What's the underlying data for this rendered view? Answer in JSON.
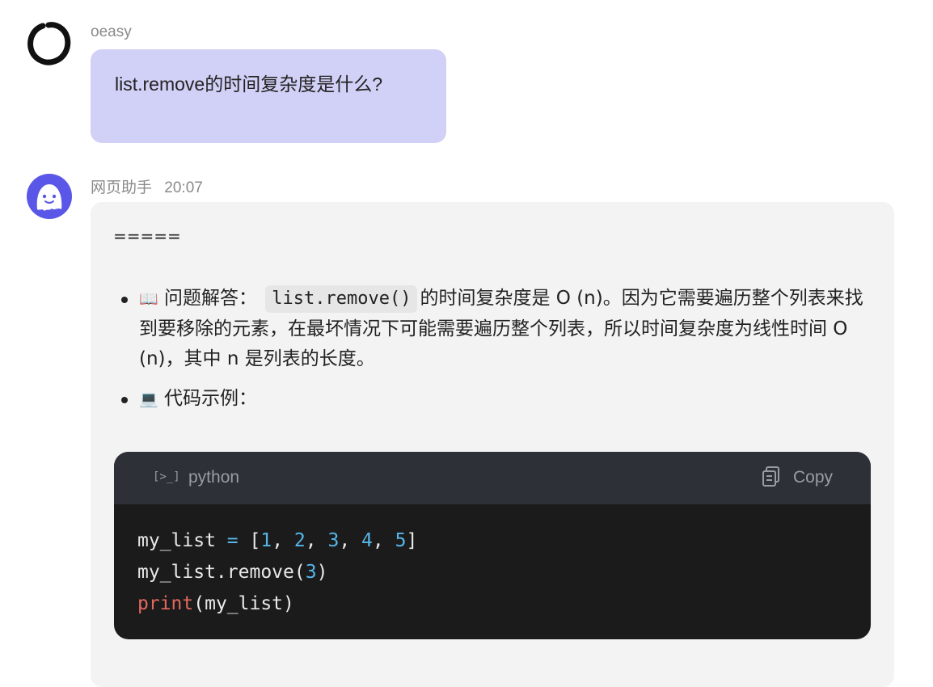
{
  "user_message": {
    "sender": "oeasy",
    "text": "list.remove的时间复杂度是什么?"
  },
  "bot_message": {
    "sender": "网页助手",
    "time": "20:07",
    "separator": "=====",
    "answer": {
      "emoji": "📖",
      "label": "问题解答：",
      "code": "list.remove()",
      "text": "的时间复杂度是 O (n)。因为它需要遍历整个列表来找到要移除的元素，在最坏情况下可能需要遍历整个列表，所以时间复杂度为线性时间 O (n)，其中 n 是列表的长度。"
    },
    "example": {
      "emoji": "💻",
      "label": "代码示例："
    },
    "code_block": {
      "language": "python",
      "copy_label": "Copy",
      "lines": [
        [
          {
            "t": "my_list ",
            "c": "plain"
          },
          {
            "t": "=",
            "c": "op"
          },
          {
            "t": " [",
            "c": "plain"
          },
          {
            "t": "1",
            "c": "num"
          },
          {
            "t": ", ",
            "c": "plain"
          },
          {
            "t": "2",
            "c": "num"
          },
          {
            "t": ", ",
            "c": "plain"
          },
          {
            "t": "3",
            "c": "num"
          },
          {
            "t": ", ",
            "c": "plain"
          },
          {
            "t": "4",
            "c": "num"
          },
          {
            "t": ", ",
            "c": "plain"
          },
          {
            "t": "5",
            "c": "num"
          },
          {
            "t": "]",
            "c": "plain"
          }
        ],
        [
          {
            "t": "my_list.remove(",
            "c": "plain"
          },
          {
            "t": "3",
            "c": "num"
          },
          {
            "t": ")",
            "c": "plain"
          }
        ],
        [
          {
            "t": "print",
            "c": "fn"
          },
          {
            "t": "(my_list)",
            "c": "plain"
          }
        ]
      ]
    }
  },
  "colors": {
    "user_bubble": "#d1d0f6",
    "bot_avatar": "#5a57e8",
    "reply_bubble": "#f3f3f3",
    "code_header": "#2e3038",
    "code_body": "#1b1b1b"
  }
}
